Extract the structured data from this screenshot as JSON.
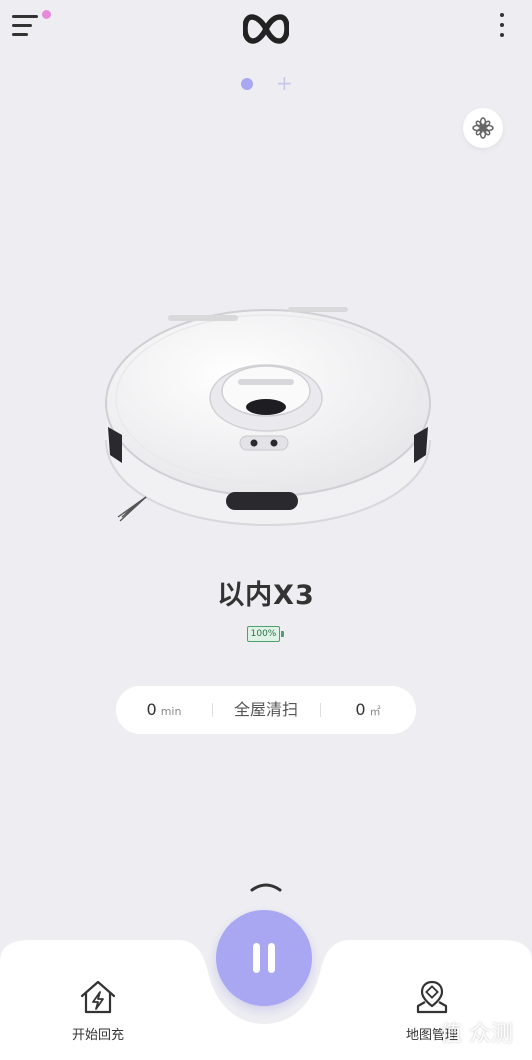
{
  "header": {
    "menu_icon": "menu-icon",
    "logo_icon": "infinity-logo-icon",
    "more_icon": "more-vertical-icon"
  },
  "pager": {
    "add_label": "+"
  },
  "mode_button": {
    "icon": "fan-icon"
  },
  "device": {
    "name": "以内X3",
    "battery": "100%"
  },
  "stats": {
    "time_value": "0",
    "time_unit": "min",
    "mode_label": "全屋清扫",
    "area_value": "0",
    "area_unit": "㎡"
  },
  "actions": {
    "expand_icon": "chevron-up-icon",
    "pause_icon": "pause-icon",
    "recharge_label": "开始回充",
    "map_label": "地图管理"
  },
  "watermark": {
    "text": "值 众测"
  },
  "colors": {
    "accent": "#a9a6f2",
    "background": "#eeeef2",
    "notification": "#e68ad9",
    "battery": "#4fa06f"
  }
}
